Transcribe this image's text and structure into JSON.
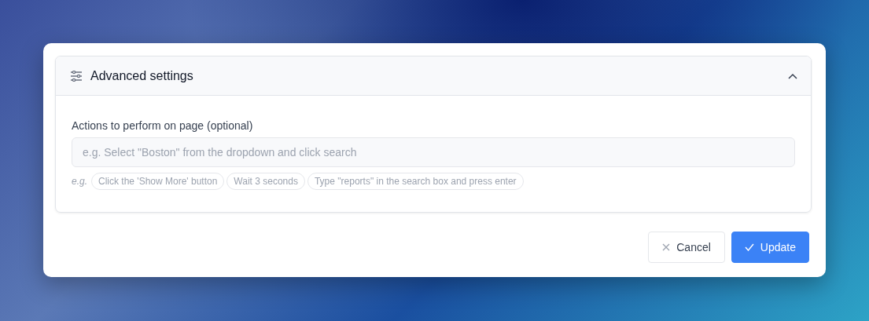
{
  "section": {
    "title": "Advanced settings",
    "expanded": true
  },
  "actions": {
    "label": "Actions to perform on page (optional)",
    "placeholder": "e.g. Select \"Boston\" from the dropdown and click search"
  },
  "examples": {
    "prefix": "e.g.",
    "chips": [
      "Click the 'Show More' button",
      "Wait 3 seconds",
      "Type \"reports\" in the search box and press enter"
    ]
  },
  "buttons": [
    {
      "kind": "cancel",
      "label": "Cancel"
    },
    {
      "kind": "update",
      "label": "Update"
    }
  ]
}
